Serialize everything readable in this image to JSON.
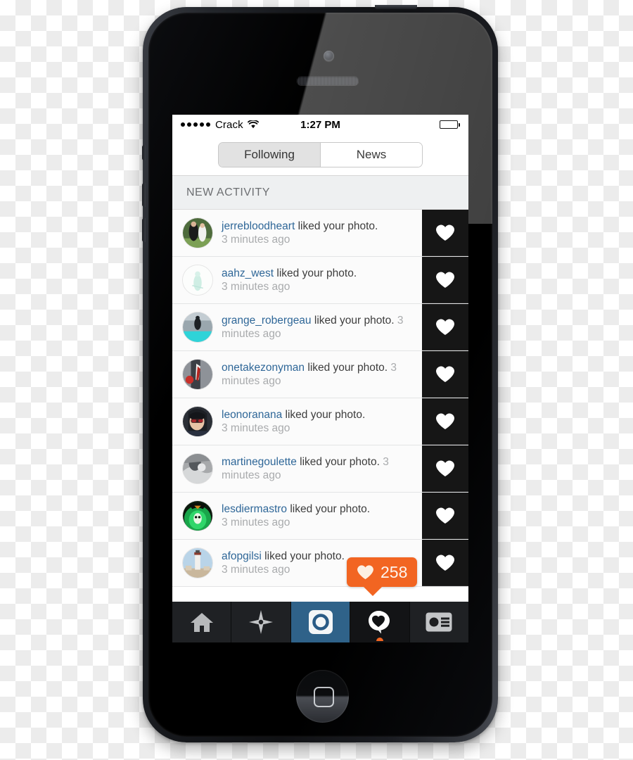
{
  "status_bar": {
    "carrier": "Crack",
    "signal_dots": 5,
    "wifi_icon": "wifi-icon",
    "time": "1:27 PM",
    "battery_icon": "battery-full-icon"
  },
  "segmented_control": {
    "options": [
      {
        "label": "Following",
        "selected": true
      },
      {
        "label": "News",
        "selected": false
      }
    ]
  },
  "section": {
    "header": "NEW ACTIVITY"
  },
  "activity": [
    {
      "username": "jerrebloodheart",
      "action": " liked your photo.",
      "time": "3 minutes ago",
      "thumb_icon": "heart-icon",
      "avatar": "photo-two-people"
    },
    {
      "username": "aahz_west",
      "action": " liked your photo.",
      "time": "3 minutes ago",
      "thumb_icon": "heart-icon",
      "avatar": "photo-faint-teal"
    },
    {
      "username": "grange_robergeau",
      "action": " liked your photo.",
      "time": "3 minutes ago",
      "thumb_icon": "heart-icon",
      "avatar": "photo-pool-jump"
    },
    {
      "username": "onetakezonyman",
      "action": " liked your photo.",
      "time": "3 minutes ago",
      "thumb_icon": "heart-icon",
      "avatar": "photo-suit-red"
    },
    {
      "username": "leonoranana",
      "action": " liked your photo.",
      "time": "3 minutes ago",
      "thumb_icon": "heart-icon",
      "avatar": "photo-sunglasses"
    },
    {
      "username": "martinegoulette",
      "action": " liked your photo.",
      "time": "3 minutes ago",
      "thumb_icon": "heart-icon",
      "avatar": "photo-grayscale"
    },
    {
      "username": "lesdiermastro",
      "action": " liked your photo.",
      "time": "3 minutes ago",
      "thumb_icon": "heart-icon",
      "avatar": "photo-green-skull"
    },
    {
      "username": "afopgilsi",
      "action": " liked your photo.",
      "time": "3 minutes ago",
      "thumb_icon": "heart-icon",
      "avatar": "photo-lighthouse"
    }
  ],
  "like_badge": {
    "count": "258",
    "icon": "heart-icon",
    "color": "#f26522"
  },
  "tab_bar": [
    {
      "name": "home",
      "icon": "home-icon",
      "active": false
    },
    {
      "name": "explore",
      "icon": "compass-star-icon",
      "active": false
    },
    {
      "name": "camera",
      "icon": "camera-icon",
      "active": true
    },
    {
      "name": "activity",
      "icon": "heart-bubble-icon",
      "active": true
    },
    {
      "name": "profile",
      "icon": "profile-card-icon",
      "active": false
    }
  ],
  "colors": {
    "username_blue": "#2f6798",
    "badge_orange": "#f26522",
    "camera_tab_blue": "#2f6289",
    "tab_bar_dark": "#1f2124"
  }
}
